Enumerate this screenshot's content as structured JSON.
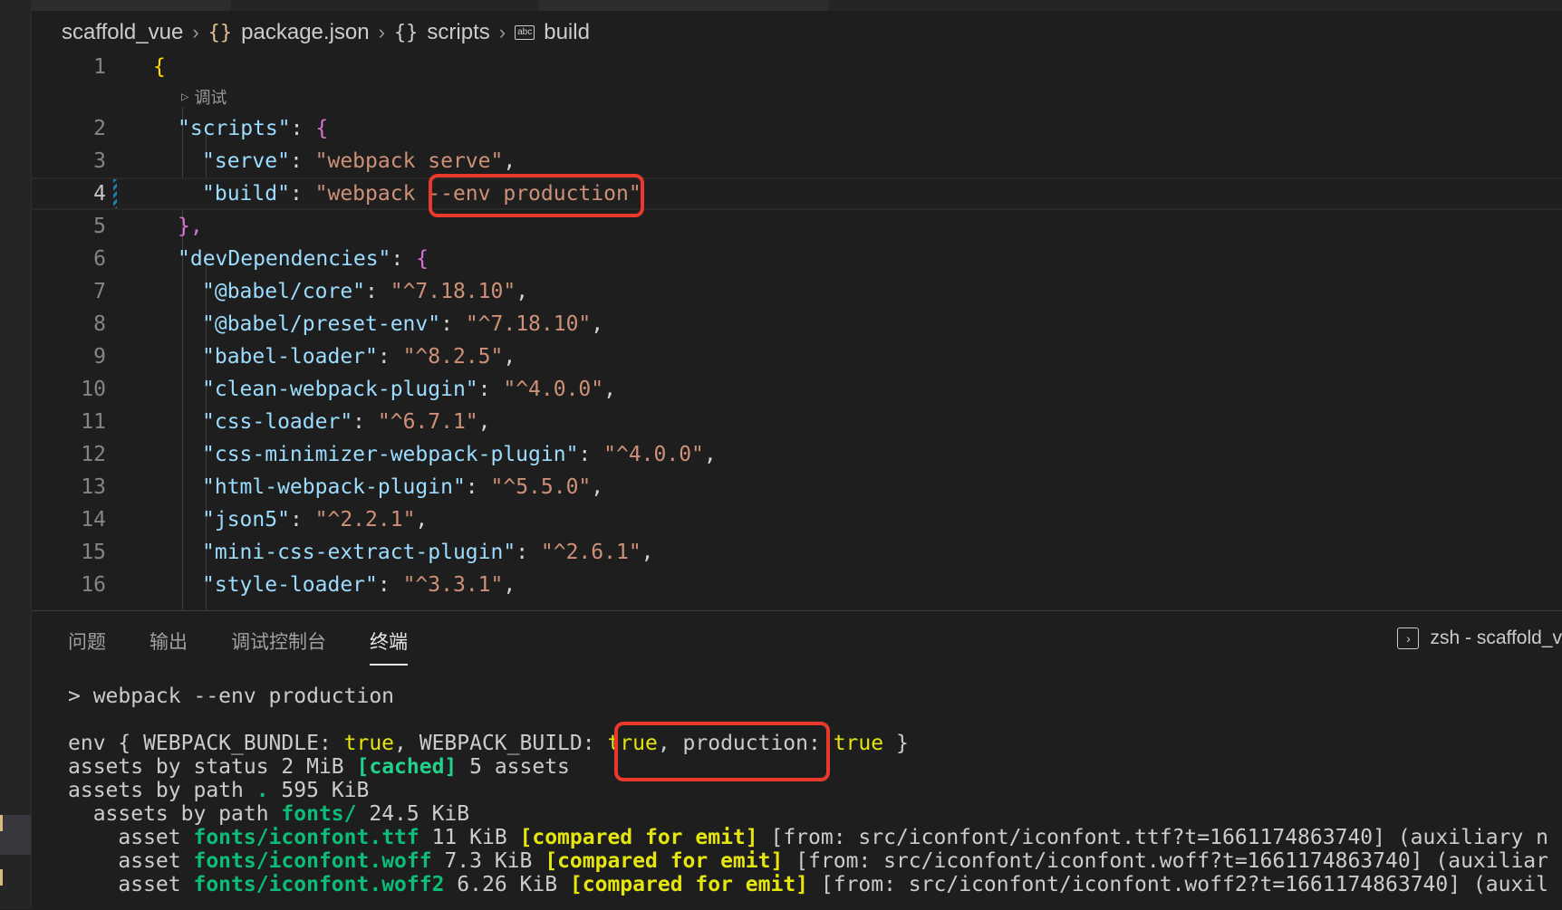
{
  "breadcrumb": {
    "project": "scaffold_vue",
    "file": "package.json",
    "section": "scripts",
    "key": "build",
    "json_icon": "{}",
    "braces_icon": "{}",
    "abc_icon": "abc"
  },
  "editor": {
    "codelens_label": "调试",
    "lines": [
      {
        "num": "1"
      },
      {
        "num": "2",
        "key": "\"scripts\"",
        "open": "{"
      },
      {
        "num": "3",
        "key": "\"serve\"",
        "value": "\"webpack serve\""
      },
      {
        "num": "4",
        "key": "\"build\"",
        "value_a": "\"webpack ",
        "value_b": "--env production\""
      },
      {
        "num": "5",
        "close": "},"
      },
      {
        "num": "6",
        "key": "\"devDependencies\"",
        "open": "{"
      },
      {
        "num": "7",
        "key": "\"@babel/core\"",
        "value": "\"^7.18.10\""
      },
      {
        "num": "8",
        "key": "\"@babel/preset-env\"",
        "value": "\"^7.18.10\""
      },
      {
        "num": "9",
        "key": "\"babel-loader\"",
        "value": "\"^8.2.5\""
      },
      {
        "num": "10",
        "key": "\"clean-webpack-plugin\"",
        "value": "\"^4.0.0\""
      },
      {
        "num": "11",
        "key": "\"css-loader\"",
        "value": "\"^6.7.1\""
      },
      {
        "num": "12",
        "key": "\"css-minimizer-webpack-plugin\"",
        "value": "\"^4.0.0\""
      },
      {
        "num": "13",
        "key": "\"html-webpack-plugin\"",
        "value": "\"^5.5.0\""
      },
      {
        "num": "14",
        "key": "\"json5\"",
        "value": "\"^2.2.1\""
      },
      {
        "num": "15",
        "key": "\"mini-css-extract-plugin\"",
        "value": "\"^2.6.1\""
      },
      {
        "num": "16",
        "key": "\"style-loader\"",
        "value": "\"^3.3.1\""
      }
    ]
  },
  "panel": {
    "tabs": [
      "问题",
      "输出",
      "调试控制台",
      "终端"
    ],
    "active_tab": "终端",
    "terminal_label": "zsh - scaffold_v"
  },
  "terminal": {
    "cmd": "> webpack --env production",
    "env_prefix": "env { WEBPACK_BUNDLE: ",
    "true1": "true",
    "env_mid": ", WEBPACK_BUILD: ",
    "true2": "true",
    "comma": ",",
    "prod_key": " production: ",
    "true3": "true",
    "env_close": " }",
    "status_prefix": "assets by status 2 MiB ",
    "cached": "[cached]",
    "status_suffix": " 5 assets",
    "path_prefix": "assets by path ",
    "path_dot": ".",
    "path_suffix": " 595 KiB",
    "fonts_prefix": "  assets by path ",
    "fonts_dir": "fonts/",
    "fonts_suffix": " 24.5 KiB",
    "assets": [
      {
        "prefix": "    asset ",
        "name": "fonts/iconfont.ttf",
        "size": " 11 KiB ",
        "tag": "[compared for emit]",
        "from": " [from: src/iconfont/iconfont.ttf?t=1661174863740] (auxiliary n"
      },
      {
        "prefix": "    asset ",
        "name": "fonts/iconfont.woff",
        "size": " 7.3 KiB ",
        "tag": "[compared for emit]",
        "from": " [from: src/iconfont/iconfont.woff?t=1661174863740] (auxiliar"
      },
      {
        "prefix": "    asset ",
        "name": "fonts/iconfont.woff2",
        "size": " 6.26 KiB ",
        "tag": "[compared for emit]",
        "from": " [from: src/iconfont/iconfont.woff2?t=1661174863740] (auxil"
      }
    ]
  },
  "colors": {
    "highlight_box": "#e8392a",
    "json_key": "#9cdcfe",
    "json_string": "#ce9178",
    "bracket_level1": "#ffd700",
    "bracket_level2": "#da70d6",
    "term_green": "#0dbc79",
    "term_yellow": "#e5e510"
  }
}
